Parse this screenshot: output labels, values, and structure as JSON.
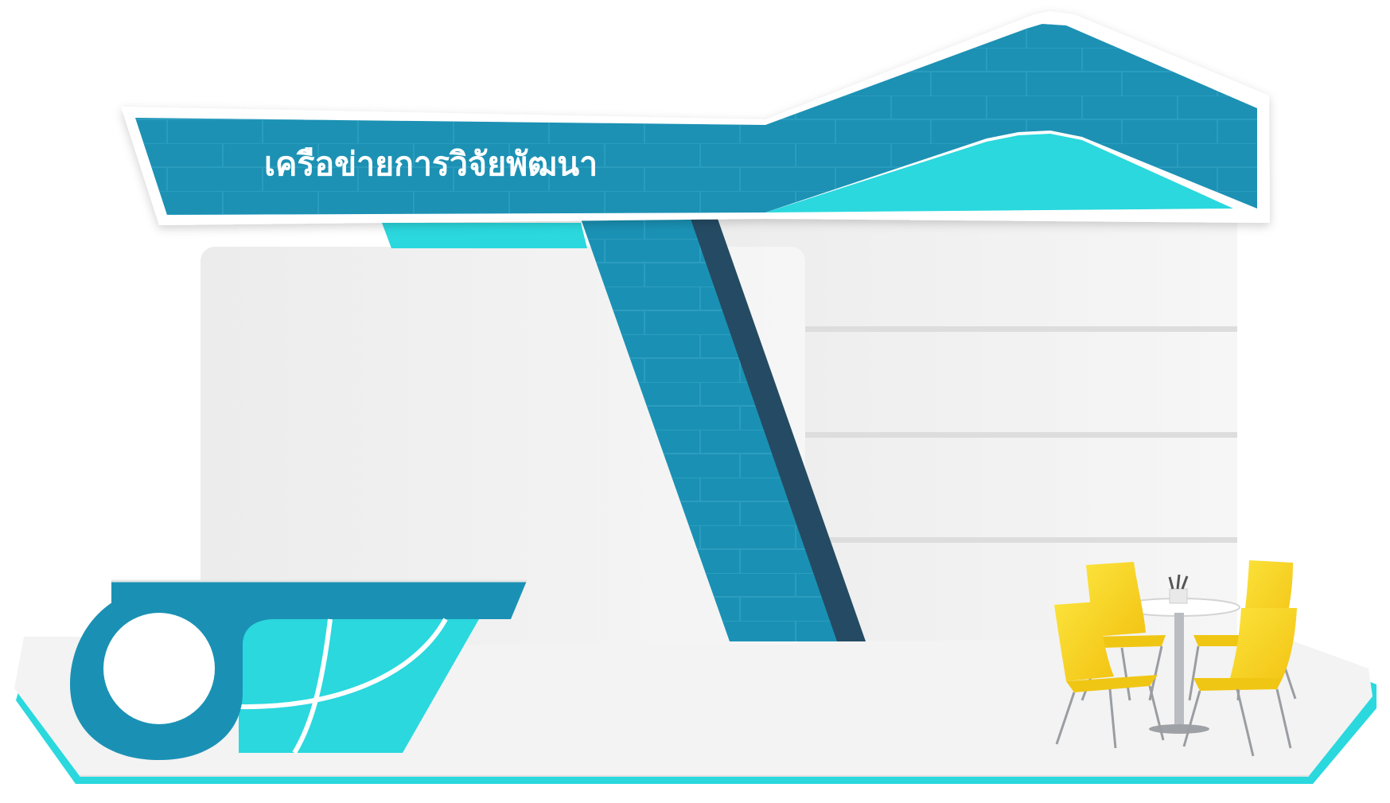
{
  "booth": {
    "title": "เครือข่ายการวิจัยพัฒนา"
  },
  "colors": {
    "primary_blue": "#1A91B4",
    "accent_cyan": "#2AD8DE",
    "dark_stripe": "#244B63",
    "wall_light": "#F3F3F3",
    "chair_yellow": "#F8D824"
  },
  "icons": {
    "round_badge": "circle-emblem",
    "table": "round-table",
    "chairs": "chair"
  }
}
